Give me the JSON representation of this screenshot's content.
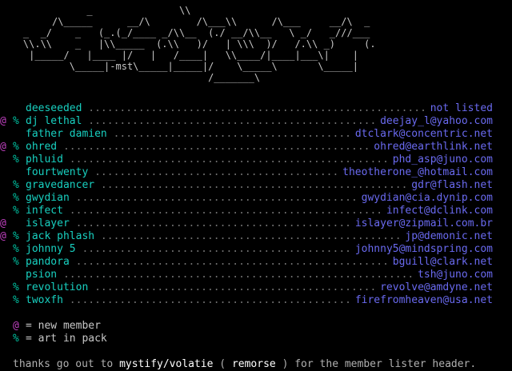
{
  "header": {
    "art": "               _               \\\\                           \n         /\\_____      __/\\        /\\___\\\\      /\\___     __/\\  _\n    _  _/    _   (_.(_/____ _/\\\\__  (./ __/\\\\__   \\ _/   _///___\n    \\\\.\\\\    _   |\\\\_____  (.\\\\   )/   | \\\\\\  )/   /.\\\\ _)     (.\n     |_____/   |____ |/   |   /____|   \\\\____/|____|___\\|    |\n            \\_____|-mst\\_____|_____|/    \\_____\\       \\_____|\n                                    /_______\\",
    "signature": "mst"
  },
  "colors": {
    "background": "#000000",
    "handle": "#18d0c0",
    "contact": "#6a6af0",
    "dots": "#707070",
    "new_marker": "#c040c0",
    "art_marker": "#00c0a0",
    "text": "#b0b0b0"
  },
  "members": [
    {
      "new": "",
      "art": "",
      "handle": "deeseeded",
      "contact": "not listed"
    },
    {
      "new": "@",
      "art": "%",
      "handle": "dj lethal",
      "contact": "deejay_l@yahoo.com"
    },
    {
      "new": "",
      "art": "",
      "handle": "father damien",
      "contact": "dtclark@concentric.net"
    },
    {
      "new": "@",
      "art": "%",
      "handle": "ohred",
      "contact": "ohred@earthlink.net"
    },
    {
      "new": "",
      "art": "%",
      "handle": "phluid",
      "contact": "phd_asp@juno.com"
    },
    {
      "new": "",
      "art": "",
      "handle": "fourtwenty",
      "contact": "theotherone_@hotmail.com"
    },
    {
      "new": "",
      "art": "%",
      "handle": "gravedancer",
      "contact": "gdr@flash.net"
    },
    {
      "new": "",
      "art": "%",
      "handle": "gwydian",
      "contact": "gwydian@cia.dynip.com"
    },
    {
      "new": "",
      "art": "%",
      "handle": "infect",
      "contact": "infect@dclink.com"
    },
    {
      "new": "@",
      "art": "",
      "handle": "islayer",
      "contact": "islayer@zipmail.com.br"
    },
    {
      "new": "@",
      "art": "%",
      "handle": "jack phlash",
      "contact": "jp@demonic.net"
    },
    {
      "new": "",
      "art": "%",
      "handle": "johnny 5",
      "contact": "johnny5@mindspring.com"
    },
    {
      "new": "",
      "art": "%",
      "handle": "pandora",
      "contact": "bguill@clark.net"
    },
    {
      "new": "",
      "art": "",
      "handle": "psion",
      "contact": "tsh@juno.com"
    },
    {
      "new": "",
      "art": "%",
      "handle": "revolution",
      "contact": "revolve@amdyne.net"
    },
    {
      "new": "",
      "art": "%",
      "handle": "twoxfh",
      "contact": "firefromheaven@usa.net"
    }
  ],
  "legend": {
    "new_symbol": "@",
    "new_text": "= new member",
    "art_symbol": "%",
    "art_text": "= art in pack"
  },
  "footer": {
    "prefix": "thanks go out to ",
    "credit": "mystify/volatie",
    "middle": " ( ",
    "group": "remorse",
    "suffix": " ) for the member lister header."
  }
}
